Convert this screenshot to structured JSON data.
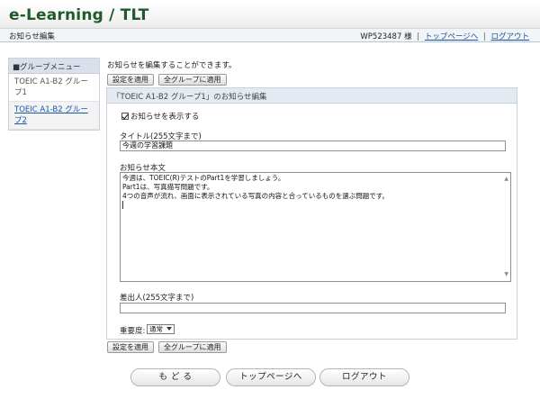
{
  "header": {
    "title": "e-Learning / TLT"
  },
  "subbar": {
    "page_label": "お知らせ編集",
    "user": "WP523487 様",
    "separator": "|",
    "top_link": "トップページへ",
    "logout_link": "ログアウト"
  },
  "sidebar": {
    "title": "■グループメニュー",
    "items": [
      {
        "label": "TOEIC A1-B2 グループ1"
      },
      {
        "label": "TOEIC A1-B2 グループ2"
      }
    ]
  },
  "main": {
    "intro": "お知らせを編集することができます。",
    "apply_button": "設定を適用",
    "apply_all_button": "全グループに適用",
    "panel_title": "「TOEIC A1-B2 グループ1」のお知らせ編集",
    "show_notice_label": "お知らせを表示する",
    "show_notice_checked": true,
    "title_label": "タイトル(255文字まで)",
    "title_value": "今週の学習課題",
    "body_label": "お知らせ本文",
    "body_lines": [
      "今週は、TOEIC(R)テストのPart1を学習しましょう。",
      "Part1は、写真描写問題です。",
      "4つの音声が流れ、画面に表示されている写真の内容と合っているものを選ぶ問題です。"
    ],
    "sender_label": "差出人(255文字まで)",
    "sender_value": "",
    "priority_label": "重要度:",
    "priority_value": "通常"
  },
  "footer": {
    "back": "も ど る",
    "top": "トップページへ",
    "logout": "ログアウト"
  }
}
